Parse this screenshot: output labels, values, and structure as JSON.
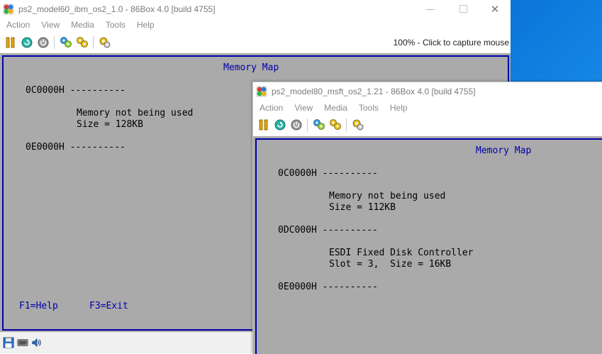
{
  "window1": {
    "title": "ps2_model60_ibm_os2_1.0 - 86Box 4.0 [build 4755]",
    "menu": [
      "Action",
      "View",
      "Media",
      "Tools",
      "Help"
    ],
    "capture_hint": "100% - Click to capture mouse",
    "screen": {
      "heading": "Memory Map",
      "line1_addr": "0C0000H ----------",
      "line2": "Memory not being used",
      "line3": "Size = 128KB",
      "line4_addr": "0E0000H ----------",
      "footer_help": "F1=Help",
      "footer_exit": "F3=Exit"
    }
  },
  "window2": {
    "title": "ps2_model80_msft_os2_1.21 - 86Box 4.0 [build 4755]",
    "menu": [
      "Action",
      "View",
      "Media",
      "Tools",
      "Help"
    ],
    "screen": {
      "heading": "Memory Map",
      "line1_addr": "0C0000H ----------",
      "line2": "Memory not being used",
      "line3": "Size = 112KB",
      "line4_addr": "0DC000H ----------",
      "line5": "ESDI Fixed Disk Controller",
      "line6": "Slot = 3,  Size = 16KB",
      "line7_addr": "0E0000H ----------"
    }
  },
  "icons": {
    "app": "86box-app-icon",
    "pause": "pause-icon",
    "reset": "reset-icon",
    "power": "power-icon",
    "ctrl_alt_del": "ctrl-alt-del-icon",
    "ctrl_alt_esc": "ctrl-alt-esc-icon",
    "settings": "settings-icon",
    "floppy": "floppy-drive-icon",
    "hdd": "hard-disk-icon",
    "sound": "sound-icon"
  },
  "colors": {
    "vga_gray": "#aaaaaa",
    "vga_blue": "#0000aa",
    "desktop_blue": "#0a74da"
  }
}
